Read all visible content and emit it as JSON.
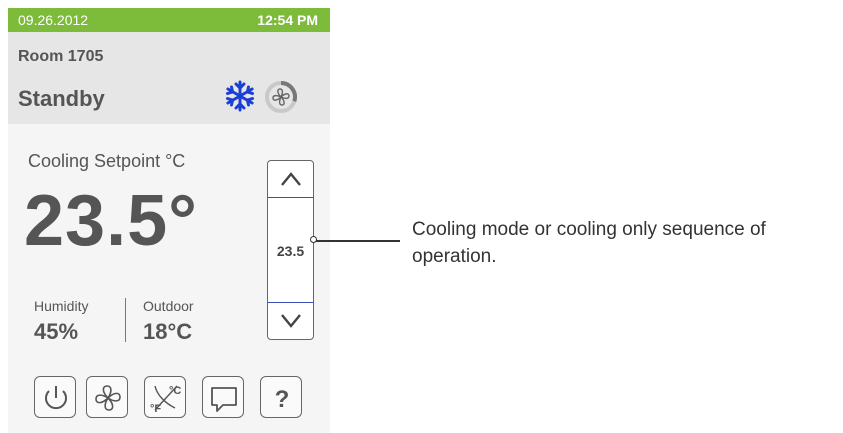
{
  "status_bar": {
    "date": "09.26.2012",
    "time": "12:54 PM"
  },
  "header": {
    "room": "Room 1705",
    "mode": "Standby"
  },
  "icons": {
    "mode_icon": "snowflake-icon",
    "fan_icon": "fan-icon"
  },
  "setpoint": {
    "label": "Cooling Setpoint °C",
    "value_display": "23.5°"
  },
  "stepper": {
    "value": "23.5",
    "up_icon": "chevron-up-icon",
    "down_icon": "chevron-down-icon"
  },
  "readings": {
    "humidity_label": "Humidity",
    "humidity_value": "45%",
    "outdoor_label": "Outdoor",
    "outdoor_value": "18°C"
  },
  "buttons": [
    {
      "icon": "power-icon"
    },
    {
      "icon": "fan-icon"
    },
    {
      "icon": "units-toggle-icon",
      "label_c": "°C",
      "label_f": "°F"
    },
    {
      "icon": "message-icon"
    },
    {
      "icon": "help-icon",
      "label": "?"
    }
  ],
  "callout": {
    "text": "Cooling mode or cooling only sequence of operation."
  },
  "colors": {
    "status_bar": "#7dbb3a",
    "snowflake": "#1a3fd6",
    "stepper_line": "#3b4fb0"
  }
}
